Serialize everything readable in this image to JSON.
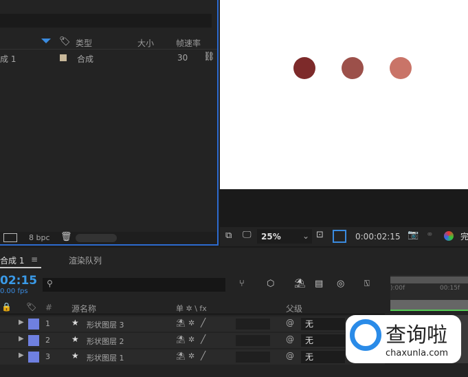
{
  "project": {
    "columns": {
      "type": "类型",
      "size": "大小",
      "fps": "帧速率"
    },
    "items": [
      {
        "name": "成 1",
        "type": "合成",
        "fps": "30",
        "label_color": "#c8b89a"
      }
    ],
    "bpc": "8 bpc"
  },
  "viewer": {
    "zoom": "25%",
    "timecode": "0:00:02:15",
    "extra": "完",
    "circles": [
      "#7d2a2a",
      "#9c504a",
      "#c97468"
    ]
  },
  "timeline": {
    "tabs": [
      {
        "label": "合成 1"
      },
      {
        "label": "渲染队列"
      }
    ],
    "timecode": "02:15",
    "fps": "0.00 fps",
    "search_placeholder": "",
    "columns": {
      "num": "#",
      "source": "源名称",
      "switches": "单 ✲ \\ fx",
      "parent": "父级"
    },
    "ruler": [
      "):00f",
      "00:15f"
    ],
    "layers": [
      {
        "num": "1",
        "name": "形状图层 3",
        "parent": "无",
        "color": "#6f80e0"
      },
      {
        "num": "2",
        "name": "形状图层 2",
        "parent": "无",
        "color": "#6f80e0"
      },
      {
        "num": "3",
        "name": "形状图层 1",
        "parent": "无",
        "color": "#6f80e0"
      }
    ]
  },
  "watermark": {
    "text": "查询啦",
    "url": "chaxunla.com"
  }
}
